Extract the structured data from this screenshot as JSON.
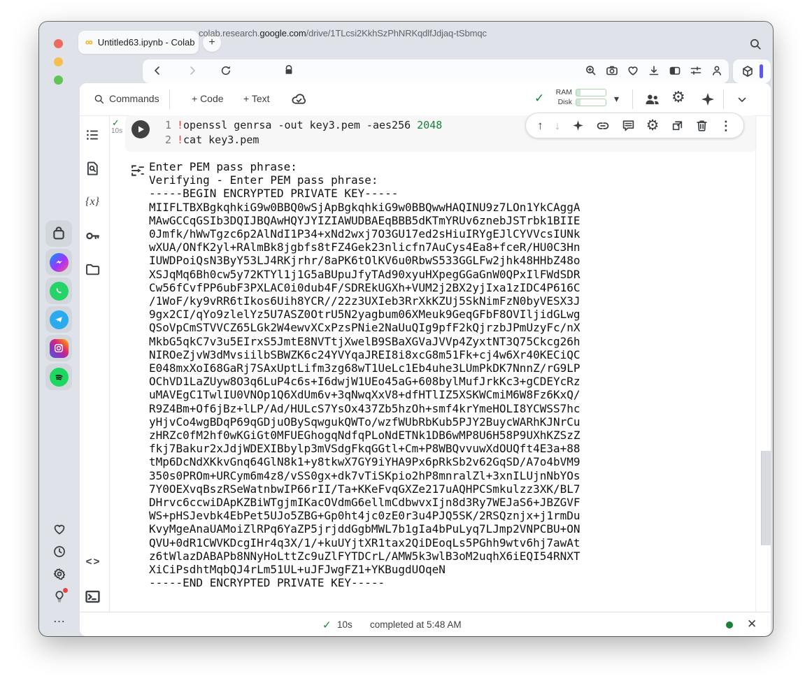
{
  "tab": {
    "title": "Untitled63.ipynb - Colab"
  },
  "address": {
    "subdomain": "colab.research.",
    "domain": "google.com",
    "path": "/drive/1TLcsi2KkhSzPhNRKqdlfJdjaq-tSbmqc"
  },
  "toolbar": {
    "commands": "Commands",
    "add_code": "+ Code",
    "add_text": "+ Text",
    "ram": "RAM",
    "disk": "Disk"
  },
  "cell": {
    "exec_time": "10s",
    "lines": [
      {
        "num": "1",
        "bang": "!",
        "code": "openssl genrsa -out key3.pem -aes256 ",
        "literal": "2048"
      },
      {
        "num": "2",
        "bang": "!",
        "code": "cat key3.pem",
        "literal": ""
      }
    ]
  },
  "output_lines": [
    "Enter PEM pass phrase:",
    "Verifying - Enter PEM pass phrase:",
    "-----BEGIN ENCRYPTED PRIVATE KEY-----",
    "MIIFLTBXBgkqhkiG9w0BBQ0wSjApBgkqhkiG9w0BBQwwHAQINU9z7LOn1YkCAggA",
    "MAwGCCqGSIb3DQIJBQAwHQYJYIZIAWUDBAEqBBB5dKTmYRUv6znebJSTrbk1BIIE",
    "0Jmfk/hWwTgzc6p2AlNdI1P34+xNd2wxj7O3GU17ed2sHiuIRYgEJlCYVVcsIUNk",
    "wXUA/ONfK2yl+RAlmBk8jgbfs8tFZ4Gek23nlicfn7AuCys4Ea8+fceR/HU0C3Hn",
    "IUWDPoiQsN3ByY53LJ4RKjrhr/8aPK6tOlKV6u0RbwS533GGLFw2jhk48HHbZ48o",
    "XSJqMq6Bh0cw5y72KTYl1j1G5aBUpuJfyTAd90xyuHXpegGGaGnW0QPxIlFWdSDR",
    "Cw56fCvfPP6ubF3PXLAC0i0dub4F/SDREkUGXh+VUM2j2BX2yjIxa1zIDC4P616C",
    "/1WoF/ky9vRR6tIkos6Uih8YCR//22z3UXIeb3RrXkKZUj5SkNimFzN0byVESX3J",
    "9gx2CI/qYo9zlelYz5U7ASZ0OtrU5N2yagbum06XMeuk9GeqGFbF8OVIljidGLwg",
    "QSoVpCmSTVVCZ65LGk2W4ewvXCxPzsPNie2NaUuQIg9pfF2kQjrzbJPmUzyFc/nX",
    "MkbG5qkC7v3u5EIrxS5JmtE8NVTtjXwelB9SBaXGVaJVVp4ZyxtNT3Q75Ckcg26h",
    "NIROeZjvW3dMvsiilbSBWZK6c24YVYqaJREI8i8xcG8m51Fk+cj4w6Xr40KECiQC",
    "E048mxXoI68GaRj7SAxUptLifm3zg68wT1UeLc1Eb4uhe3LUmPkDK7NnnZ/rG9LP",
    "OChVD1LaZUyw8O3q6LuP4c6s+I6dwjW1UEo45aG+608bylMufJrkKc3+gCDEYcRz",
    "uMAVEgC1TwlIU0VNOp1Q6XdUm6v+3qNwqXxV8+dfHTlIZ5XSKWCmiM6W8Fz6KxQ/",
    "R9Z4Bm+Of6jBz+lLP/Ad/HULcS7YsOx437Zb5hzOh+smf4krYmeHOLI8YCWSS7hc",
    "yHjvCo4wgBDqP69qGDjuOBySqwgukQWTo/wzfWUbRbKub5PJY2BuycWARhKJNrCu",
    "zHRZc0fM2hf0wKGiGt0MFUEGhogqNdfqPLoNdETNk1DB6wMP8U6H58P9UXhKZSzZ",
    "fkj7Bakur2xJdjWDEXIBbylp3mVSdgFkqGGtl+Cm+P8WBQvvuwXdOUQft4E3a+88",
    "tMp6DcNdXKkvGnq64GlN8k1+y8tkwX7GY9iYHA9Px6pRkSb2v62GqSD/A7o4bVM9",
    "350s0PROm+URCym6m4z8/vSS0gx+dk7vTiSKpio2hP8mnralZl+3xnILUjnNbYOs",
    "7Y0OEXvqBszRSeWatnbwIP66rII/Ta+KKeFvqGXZe217uAQHPCSmkulzz3XK/BL7",
    "DHrvc6ccwiDApKZBiWTgjmIKacOVdmG6ellmCdbwvxIjn8d3Ry7WEJaS6+JBZGVF",
    "WS+pHSJevbk4EbPet5UJo5ZBG+Gp0ht4jc0zE0r3u4PJQ5SK/2RSQznjx+j1rmDu",
    "KvyMgeAnaUAMoiZlRPq6YaZP5jrjddGgbMWL7b1gIa4bPuLyq7LJmp2VNPCBU+ON",
    "QVU+0dR1CWVKDcgIHr4q3X/1/+kuUYjtXR1tax2QiDEoqLs5PGhh9wtv6hj7awAt",
    "z6tWlazDABAPb8NNyHoLttZc9uZlFYTDCrL/AMW5k3wlB3oM2uqhX6iEQI54RNXT",
    "XiCiPsdhtMqbQJ4rLm51UL+uJFJwgFZ1+YKBugdUOqeN",
    "-----END ENCRYPTED PRIVATE KEY-----"
  ],
  "footer": {
    "duration": "10s",
    "status": "completed at 5:48 AM"
  },
  "glyphs": {
    "plus": "+",
    "caret_down": "▾",
    "up_arrow": "↑",
    "down_arrow": "↓",
    "more_vert": "⋮",
    "close": "✕",
    "check": "✓",
    "ellipsis": "…",
    "variables": "{x}",
    "code_snippets": "< >",
    "gear": "⚙",
    "colab_logo": "∞"
  },
  "colors": {
    "accent_blue": "#5a58f2",
    "status_green": "#188038",
    "bang_red": "#e53935",
    "literal_green": "#188038",
    "traffic_red": "#ed6a5e",
    "traffic_yellow": "#f5bf4f",
    "traffic_green": "#61c454"
  }
}
